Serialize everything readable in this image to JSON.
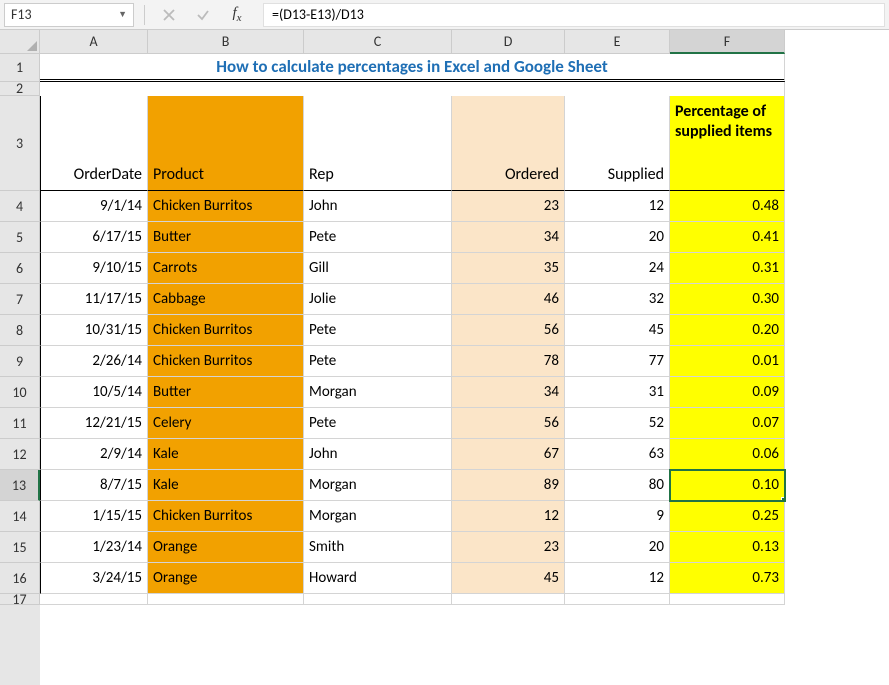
{
  "nameBox": {
    "reference": "F13"
  },
  "formulaBar": {
    "formula": "=(D13-E13)/D13"
  },
  "columns": [
    {
      "letter": "A",
      "width": "col-A"
    },
    {
      "letter": "B",
      "width": "col-B"
    },
    {
      "letter": "C",
      "width": "col-C"
    },
    {
      "letter": "D",
      "width": "col-D"
    },
    {
      "letter": "E",
      "width": "col-E"
    },
    {
      "letter": "F",
      "width": "col-F"
    }
  ],
  "selectedColumn": "F",
  "selectedRow": 13,
  "rowNumbers": [
    1,
    2,
    3,
    4,
    5,
    6,
    7,
    8,
    9,
    10,
    11,
    12,
    13,
    14,
    15,
    16,
    17
  ],
  "title": "How to calculate percentages in Excel and Google Sheet",
  "headers": {
    "A": "OrderDate",
    "B": "Product",
    "C": "Rep",
    "D": "Ordered",
    "E": "Supplied",
    "F": "Percentage of supplied items"
  },
  "data": [
    {
      "A": "9/1/14",
      "B": "Chicken Burritos",
      "C": "John",
      "D": "23",
      "E": "12",
      "F": "0.48"
    },
    {
      "A": "6/17/15",
      "B": "Butter",
      "C": "Pete",
      "D": "34",
      "E": "20",
      "F": "0.41"
    },
    {
      "A": "9/10/15",
      "B": "Carrots",
      "C": "Gill",
      "D": "35",
      "E": "24",
      "F": "0.31"
    },
    {
      "A": "11/17/15",
      "B": "Cabbage",
      "C": "Jolie",
      "D": "46",
      "E": "32",
      "F": "0.30"
    },
    {
      "A": "10/31/15",
      "B": "Chicken Burritos",
      "C": "Pete",
      "D": "56",
      "E": "45",
      "F": "0.20"
    },
    {
      "A": "2/26/14",
      "B": "Chicken Burritos",
      "C": "Pete",
      "D": "78",
      "E": "77",
      "F": "0.01"
    },
    {
      "A": "10/5/14",
      "B": "Butter",
      "C": "Morgan",
      "D": "34",
      "E": "31",
      "F": "0.09"
    },
    {
      "A": "12/21/15",
      "B": "Celery",
      "C": "Pete",
      "D": "56",
      "E": "52",
      "F": "0.07"
    },
    {
      "A": "2/9/14",
      "B": "Kale",
      "C": "John",
      "D": "67",
      "E": "63",
      "F": "0.06"
    },
    {
      "A": "8/7/15",
      "B": "Kale",
      "C": "Morgan",
      "D": "89",
      "E": "80",
      "F": "0.10"
    },
    {
      "A": "1/15/15",
      "B": "Chicken Burritos",
      "C": "Morgan",
      "D": "12",
      "E": "9",
      "F": "0.25"
    },
    {
      "A": "1/23/14",
      "B": "Orange",
      "C": "Smith",
      "D": "23",
      "E": "20",
      "F": "0.13"
    },
    {
      "A": "3/24/15",
      "B": "Orange",
      "C": "Howard",
      "D": "45",
      "E": "12",
      "F": "0.73"
    }
  ]
}
